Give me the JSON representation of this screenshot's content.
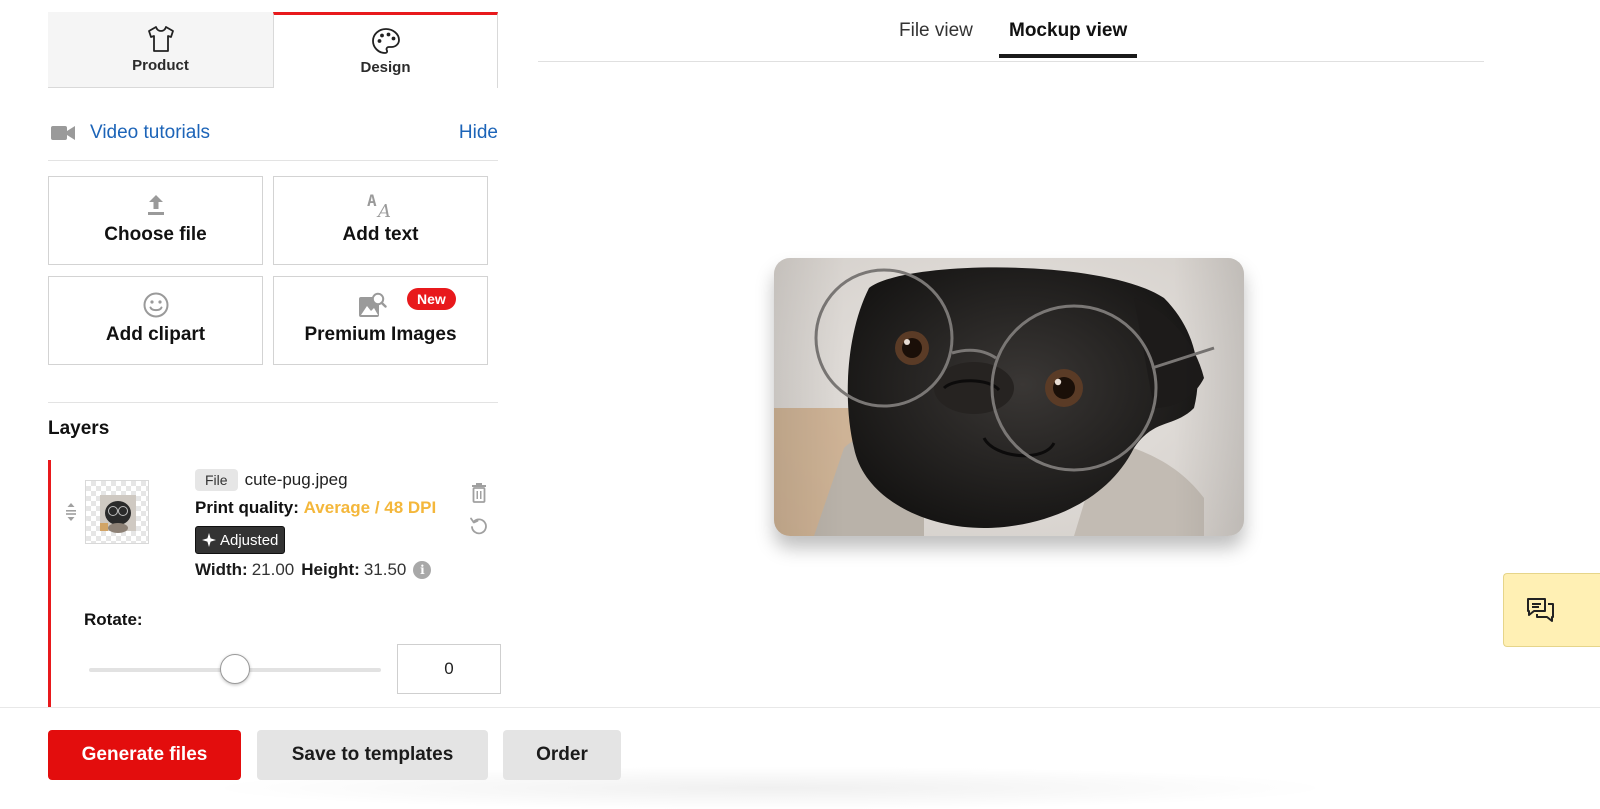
{
  "mode_tabs": [
    {
      "label": "Product",
      "icon": "tshirt-icon",
      "active": false
    },
    {
      "label": "Design",
      "icon": "palette-icon",
      "active": true
    }
  ],
  "video": {
    "link_label": "Video tutorials",
    "hide_label": "Hide",
    "icon": "video-camera-icon"
  },
  "tools": [
    {
      "label": "Choose file",
      "icon": "upload-icon"
    },
    {
      "label": "Add text",
      "icon": "text-icon"
    },
    {
      "label": "Add clipart",
      "icon": "smiley-icon"
    },
    {
      "label": "Premium Images",
      "icon": "image-search-icon",
      "badge": "New"
    }
  ],
  "layers": {
    "title": "Layers",
    "items": [
      {
        "type_chip": "File",
        "filename": "cute-pug.jpeg",
        "quality_label": "Print quality:",
        "quality_value": "Average / 48 DPI",
        "adjusted_label": "Adjusted",
        "width_label": "Width:",
        "width_value": "21.00",
        "height_label": "Height:",
        "height_value": "31.50"
      }
    ]
  },
  "rotate": {
    "label": "Rotate:",
    "value": "0",
    "min": -180,
    "max": 180
  },
  "view_tabs": [
    {
      "label": "File view",
      "active": false
    },
    {
      "label": "Mockup view",
      "active": true
    }
  ],
  "actions": {
    "generate": "Generate files",
    "save_templates": "Save to templates",
    "order": "Order"
  },
  "colors": {
    "accent_red": "#e30d0d",
    "link_blue": "#1c64b8",
    "quality_amber": "#f4b73b",
    "chat_bg": "#fff0b4"
  }
}
